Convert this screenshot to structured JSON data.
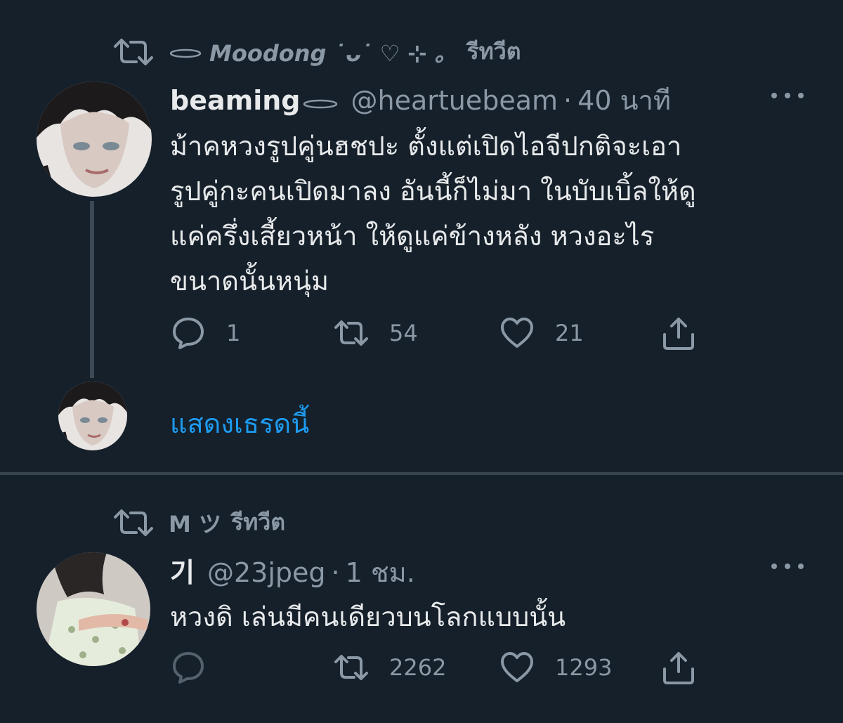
{
  "tweets": [
    {
      "retweeted_by": {
        "name": "Moodong ˙ᴗ˙ ♡ ⊹ 。",
        "suffix": "รีทวีต"
      },
      "author": {
        "display_name": "beaming",
        "handle": "@heartuebeam",
        "separator": "·",
        "time": "40 นาที"
      },
      "text_lines": [
        "ม้าคหวงรูปคู่นฮชปะ ตั้งแต่เปิดไอจีปกติจะเอา",
        "รูปคู่กะคนเปิดมาลง อันนี้ก็ไม่มา ในบับเบิ้ลให้ดู",
        "แค่ครึ่งเสี้ยวหน้า ให้ดูแค่ข้างหลัง หวงอะไร",
        "ขนาดนั้นหนุ่ม"
      ],
      "actions": {
        "reply_count": "1",
        "retweet_count": "54",
        "like_count": "21"
      },
      "show_thread": "แสดงเธรดนี้"
    },
    {
      "retweeted_by": {
        "name": "M ツ",
        "suffix": "รีทวีต"
      },
      "author": {
        "display_name": "기",
        "handle": "@23jpeg",
        "separator": "·",
        "time": "1 ชม."
      },
      "text_lines": [
        "หวงดิ เล่นมีคนเดียวบนโลกแบบนั้น"
      ],
      "actions": {
        "reply_count": "",
        "retweet_count": "2262",
        "like_count": "1293"
      }
    }
  ],
  "icons": {
    "retweet": "retweet-icon",
    "reply": "reply-icon",
    "like": "heart-icon",
    "share": "share-icon",
    "more": "more-icon"
  },
  "colors": {
    "background": "#15202b",
    "text": "#e7e9ea",
    "secondary": "#8b98a5",
    "link": "#1d9bf0",
    "divider": "#38444d"
  }
}
